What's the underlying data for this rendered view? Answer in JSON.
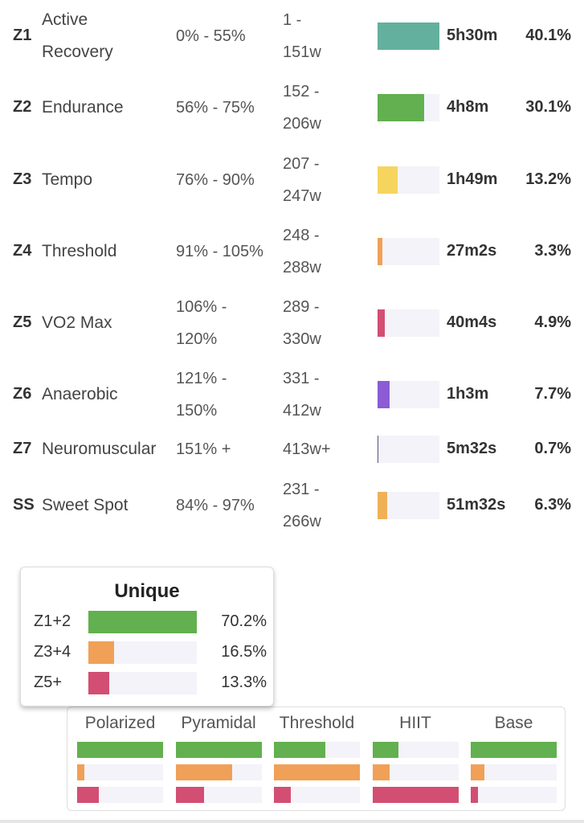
{
  "colors": {
    "z1": "#63b09e",
    "z2": "#62b04f",
    "z3": "#f5d55e",
    "z4": "#f0a057",
    "z5": "#d34e73",
    "z6": "#8b5cd6",
    "z7": "#555577",
    "ss": "#f0b057",
    "green": "#62b04f",
    "orange": "#f0a057",
    "pink": "#d34e73",
    "track": "#f3f3f9"
  },
  "zones": [
    {
      "id": "Z1",
      "name": "Active Recovery",
      "pct": "0% - 55%",
      "watts": "1 - 151w",
      "time": "5h30m",
      "percent": "40.1%",
      "value": 40.1,
      "color": "#63b09e"
    },
    {
      "id": "Z2",
      "name": "Endurance",
      "pct": "56% - 75%",
      "watts": "152 - 206w",
      "time": "4h8m",
      "percent": "30.1%",
      "value": 30.1,
      "color": "#62b04f"
    },
    {
      "id": "Z3",
      "name": "Tempo",
      "pct": "76% - 90%",
      "watts": "207 - 247w",
      "time": "1h49m",
      "percent": "13.2%",
      "value": 13.2,
      "color": "#f5d55e"
    },
    {
      "id": "Z4",
      "name": "Threshold",
      "pct": "91% - 105%",
      "watts": "248 - 288w",
      "time": "27m2s",
      "percent": "3.3%",
      "value": 3.3,
      "color": "#f0a057"
    },
    {
      "id": "Z5",
      "name": "VO2 Max",
      "pct": "106% - 120%",
      "watts": "289 - 330w",
      "time": "40m4s",
      "percent": "4.9%",
      "value": 4.9,
      "color": "#d34e73"
    },
    {
      "id": "Z6",
      "name": "Anaerobic",
      "pct": "121% - 150%",
      "watts": "331 - 412w",
      "time": "1h3m",
      "percent": "7.7%",
      "value": 7.7,
      "color": "#8b5cd6"
    },
    {
      "id": "Z7",
      "name": "Neuromuscular",
      "pct": "151% +",
      "watts": "413w+",
      "time": "5m32s",
      "percent": "0.7%",
      "value": 0.7,
      "color": "#555577"
    },
    {
      "id": "SS",
      "name": "Sweet Spot",
      "pct": "84% - 97%",
      "watts": "231 - 266w",
      "time": "51m32s",
      "percent": "6.3%",
      "value": 6.3,
      "color": "#f0b057"
    }
  ],
  "unique": {
    "title": "Unique",
    "rows": [
      {
        "label": "Z1+2",
        "percent": "70.2%",
        "value": 70.2,
        "color": "#62b04f"
      },
      {
        "label": "Z3+4",
        "percent": "16.5%",
        "value": 16.5,
        "color": "#f0a057"
      },
      {
        "label": "Z5+",
        "percent": "13.3%",
        "value": 13.3,
        "color": "#d34e73"
      }
    ]
  },
  "models": [
    {
      "name": "Polarized",
      "fills": [
        1.0,
        0.08,
        0.25
      ]
    },
    {
      "name": "Pyramidal",
      "fills": [
        1.0,
        0.66,
        0.33
      ]
    },
    {
      "name": "Threshold",
      "fills": [
        0.6,
        1.0,
        0.2
      ]
    },
    {
      "name": "HIIT",
      "fills": [
        0.3,
        0.2,
        1.0
      ]
    },
    {
      "name": "Base",
      "fills": [
        1.0,
        0.16,
        0.08
      ]
    }
  ]
}
